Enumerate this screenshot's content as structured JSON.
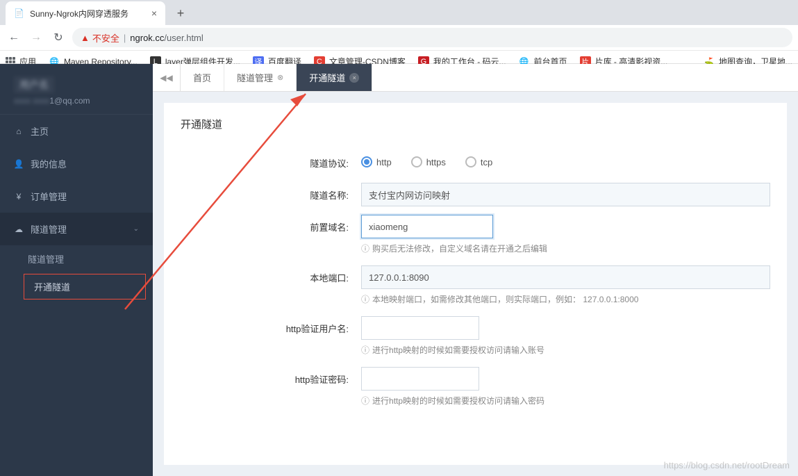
{
  "browser": {
    "tab_title": "Sunny-Ngrok内网穿透服务",
    "security_label": "不安全",
    "url_prefix": "ngrok.cc",
    "url_path": "/user.html"
  },
  "bookmarks": {
    "apps": "应用",
    "items": [
      "Maven Repository...",
      "layer弹层组件开发...",
      "百度翻译",
      "文章管理-CSDN博客",
      "我的工作台 - 码云...",
      "前台首页",
      "片库 - 高清影视资...",
      "地图查询，卫星地..."
    ]
  },
  "sidebar": {
    "user_name": "用户名",
    "user_email_masked": "1@qq.com",
    "items": [
      {
        "icon": "home",
        "label": "主页"
      },
      {
        "icon": "user",
        "label": "我的信息"
      },
      {
        "icon": "yen",
        "label": "订单管理"
      },
      {
        "icon": "cloud",
        "label": "隧道管理",
        "expanded": true
      }
    ],
    "sub_items": [
      "隧道管理",
      "开通隧道"
    ]
  },
  "content_tabs": [
    "首页",
    "隧道管理",
    "开通隧道"
  ],
  "form": {
    "title": "开通隧道",
    "fields": {
      "protocol": {
        "label": "隧道协议:",
        "options": [
          "http",
          "https",
          "tcp"
        ],
        "value": "http"
      },
      "name": {
        "label": "隧道名称:",
        "value": "支付宝内网访问映射"
      },
      "domain": {
        "label": "前置域名:",
        "value": "xiaomeng",
        "help": "购买后无法修改，自定义域名请在开通之后编辑"
      },
      "port": {
        "label": "本地端口:",
        "value": "127.0.0.1:8090",
        "help": "本地映射端口，如需修改其他端口，则实际端口，例如：  127.0.0.1:8000"
      },
      "auth_user": {
        "label": "http验证用户名:",
        "value": "",
        "help": "进行http映射的时候如需要授权访问请输入账号"
      },
      "auth_pass": {
        "label": "http验证密码:",
        "value": "",
        "help": "进行http映射的时候如需要授权访问请输入密码"
      }
    }
  },
  "watermark": "https://blog.csdn.net/rootDream"
}
